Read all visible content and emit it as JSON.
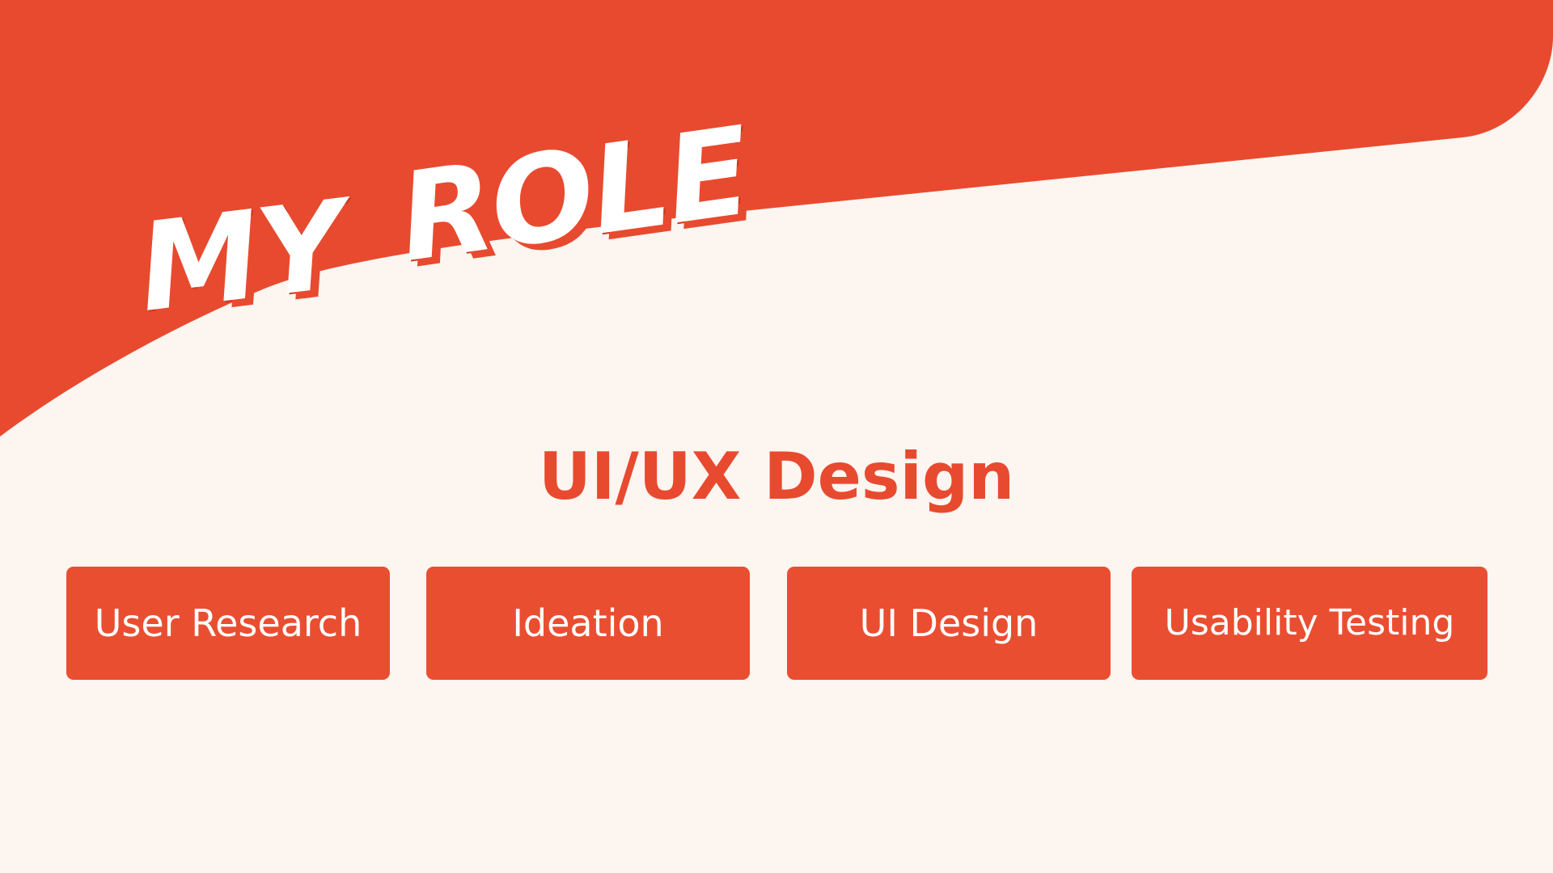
{
  "colors": {
    "background": "#FDF5F0",
    "accent": "#E84A2F",
    "text_on_accent": "#FFFFFF"
  },
  "hero": {
    "word_1": "MY",
    "word_2": "ROLE"
  },
  "section": {
    "heading": "UI/UX Design"
  },
  "skills": [
    {
      "label": "User Research"
    },
    {
      "label": "Ideation"
    },
    {
      "label": "UI Design"
    },
    {
      "label": "Usability Testing"
    }
  ]
}
